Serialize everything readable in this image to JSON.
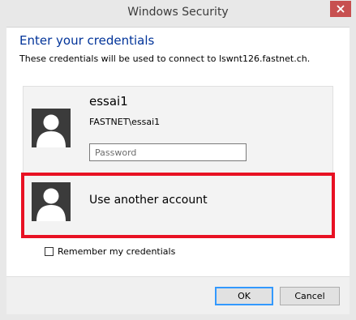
{
  "window": {
    "title": "Windows Security",
    "close_icon": "close-icon"
  },
  "dialog": {
    "heading": "Enter your credentials",
    "subtext": "These credentials will be used to connect to lswnt126.fastnet.ch."
  },
  "account": {
    "username": "essai1",
    "domain_user": "FASTNET\\essai1",
    "password_placeholder": "Password",
    "avatar_icon": "user-silhouette-icon"
  },
  "other_account": {
    "label": "Use another account",
    "avatar_icon": "user-silhouette-icon"
  },
  "remember": {
    "label": "Remember my credentials",
    "checked": false
  },
  "buttons": {
    "ok": "OK",
    "cancel": "Cancel"
  },
  "colors": {
    "heading": "#003399",
    "highlight": "#e81123",
    "close_button": "#c75050",
    "avatar_bg": "#3b3b3b"
  }
}
